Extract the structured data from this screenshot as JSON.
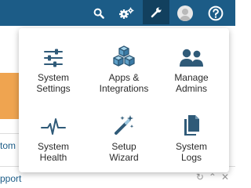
{
  "topbar": {
    "icons": [
      "search-icon",
      "gears-icon",
      "wrench-icon",
      "user-avatar-icon",
      "help-icon"
    ],
    "active_icon": "wrench-icon"
  },
  "background": {
    "link_fragment_1": "tom",
    "link_fragment_2": "pport"
  },
  "menu": {
    "items": [
      {
        "line1": "System",
        "line2": "Settings",
        "icon": "sliders-icon"
      },
      {
        "line1": "Apps &",
        "line2": "Integrations",
        "icon": "cubes-icon"
      },
      {
        "line1": "Manage",
        "line2": "Admins",
        "icon": "users-icon"
      },
      {
        "line1": "System",
        "line2": "Health",
        "icon": "pulse-icon"
      },
      {
        "line1": "Setup",
        "line2": "Wizard",
        "icon": "magic-wand-icon"
      },
      {
        "line1": "System",
        "line2": "Logs",
        "icon": "documents-icon"
      }
    ]
  },
  "colors": {
    "topbar": "#1c5c87",
    "active_tab": "#12405e",
    "icon": "#2f5a78",
    "accent_orange": "#efa450"
  }
}
